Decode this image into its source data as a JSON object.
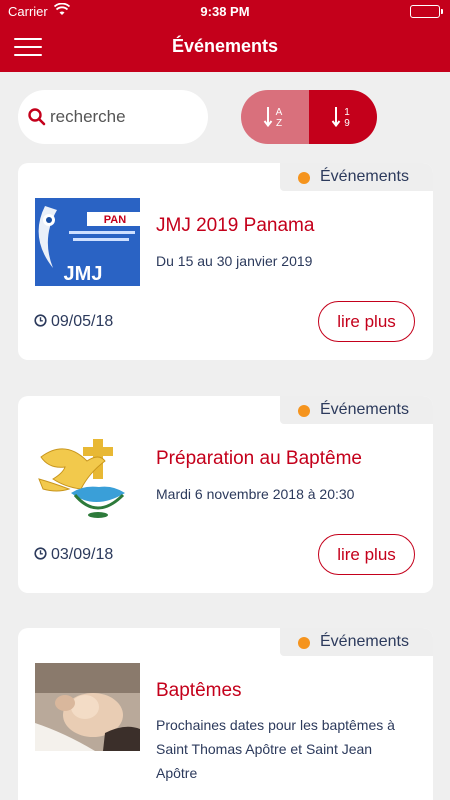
{
  "status_bar": {
    "carrier": "Carrier",
    "time": "9:38 PM"
  },
  "header": {
    "title": "Événements"
  },
  "search": {
    "placeholder": "recherche",
    "value": ""
  },
  "sort": {
    "alpha_top": "A",
    "alpha_bottom": "Z",
    "num_top": "1",
    "num_bottom": "9"
  },
  "colors": {
    "primary": "#c4001b",
    "sort_inactive": "#d9707c",
    "badge_dot": "#f5941e",
    "text_dark": "#2c3a5c",
    "background": "#efefef"
  },
  "events": [
    {
      "category": "Événements",
      "title": "JMJ 2019 Panama",
      "description": [
        "Du 15 au 30 janvier 2019"
      ],
      "date": "09/05/18",
      "button": "lire plus",
      "thumb": {
        "banner": "PAN",
        "logo": "JMJ"
      }
    },
    {
      "category": "Événements",
      "title": "Préparation au Baptême",
      "description": [
        "Mardi 6 novembre 2018 à 20:30"
      ],
      "date": "03/09/18",
      "button": "lire plus",
      "thumb": {}
    },
    {
      "category": "Événements",
      "title": "Baptêmes",
      "description": [
        "Prochaines dates pour les baptêmes à",
        "Saint Thomas Apôtre et Saint Jean",
        "Apôtre"
      ],
      "date": "",
      "button": "",
      "thumb": {}
    }
  ]
}
